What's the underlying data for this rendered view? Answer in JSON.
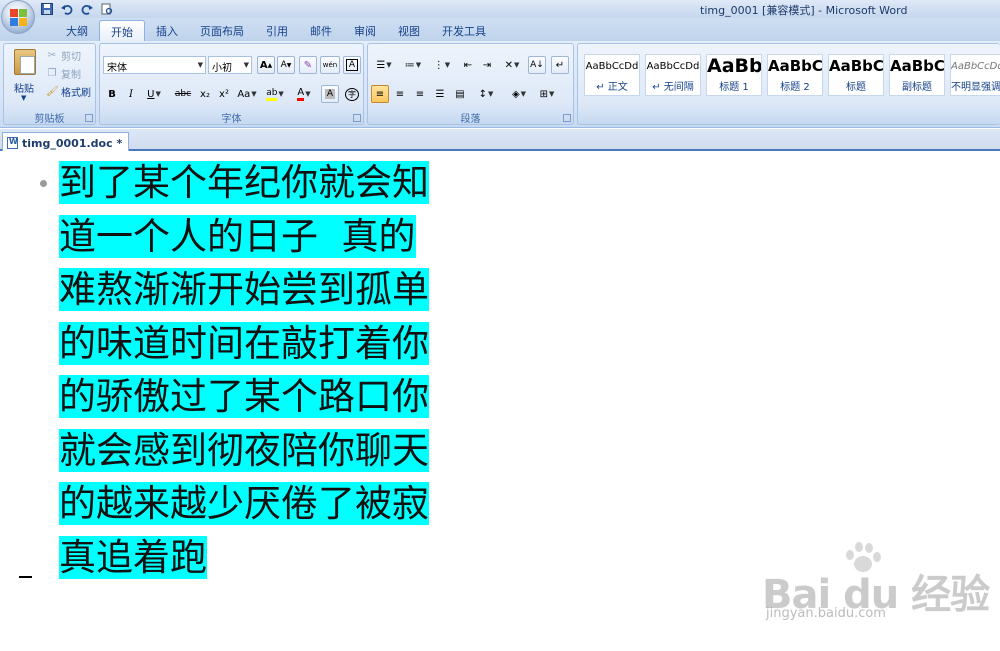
{
  "window": {
    "title": "timg_0001 [兼容模式] - Microsoft Word"
  },
  "quick_access": [
    {
      "icon": "save-icon"
    },
    {
      "icon": "undo-icon"
    },
    {
      "icon": "redo-icon"
    },
    {
      "icon": "print-preview-icon"
    }
  ],
  "tabs": [
    "大纲",
    "开始",
    "插入",
    "页面布局",
    "引用",
    "邮件",
    "审阅",
    "视图",
    "开发工具"
  ],
  "active_tab": "开始",
  "clipboard": {
    "label": "剪贴板",
    "paste": "粘贴",
    "cut": "剪切",
    "copy": "复制",
    "format_painter": "格式刷"
  },
  "font": {
    "label": "字体",
    "font_name": "宋体",
    "font_size": "小初",
    "grow_label": "A",
    "shrink_label": "A",
    "phonetic_label": "wén",
    "bold": "B",
    "italic": "I",
    "underline": "U",
    "strike": "abc",
    "subscript": "x₂",
    "superscript": "x²",
    "change_case": "Aa",
    "font_color_label": "A",
    "char_shading_label": "A",
    "enclose_label": "字",
    "highlight_color": "#ffff00",
    "font_color": "#ff0000"
  },
  "paragraph": {
    "label": "段落"
  },
  "styles": [
    {
      "sample": "AaBbCcDd",
      "name": "↵ 正文"
    },
    {
      "sample": "AaBbCcDd",
      "name": "↵ 无间隔"
    },
    {
      "sample": "AaBb",
      "name": "标题 1"
    },
    {
      "sample": "AaBbC",
      "name": "标题 2"
    },
    {
      "sample": "AaBbC",
      "name": "标题"
    },
    {
      "sample": "AaBbC",
      "name": "副标题"
    },
    {
      "sample": "AaBbCcDd",
      "name": "不明显强调"
    }
  ],
  "document": {
    "tab_label": "timg_0001.doc *",
    "paragraph_lines": [
      "到了某个年纪你就会知",
      "道一个人的日子  真的",
      "难熬渐渐开始尝到孤单",
      "的味道时间在敲打着你",
      "的骄傲过了某个路口你",
      "就会感到彻夜陪你聊天",
      "的越来越少厌倦了被寂",
      "真追着跑"
    ],
    "highlight_color": "#00ffff"
  },
  "watermark": {
    "brand": "Bai du 经验",
    "url": "jingyan.baidu.com"
  }
}
